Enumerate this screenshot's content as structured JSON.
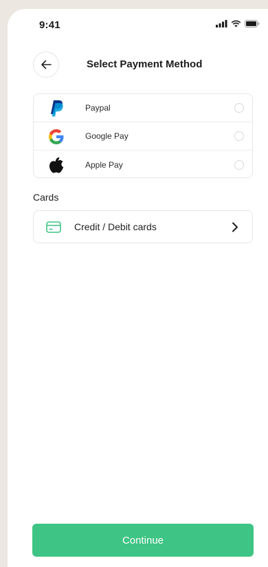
{
  "status_bar": {
    "time": "9:41"
  },
  "header": {
    "title": "Select Payment Method"
  },
  "wallets": [
    {
      "label": "Paypal",
      "icon": "paypal-logo-icon"
    },
    {
      "label": "Google Pay",
      "icon": "google-logo-icon"
    },
    {
      "label": "Apple Pay",
      "icon": "apple-logo-icon"
    }
  ],
  "cards_section": {
    "title": "Cards",
    "item_label": "Credit / Debit cards",
    "icon": "credit-card-icon"
  },
  "continue_label": "Continue",
  "colors": {
    "accent": "#3ec484",
    "background": "#ece8e1",
    "paypal_dark": "#003087",
    "paypal_light": "#009cde"
  }
}
